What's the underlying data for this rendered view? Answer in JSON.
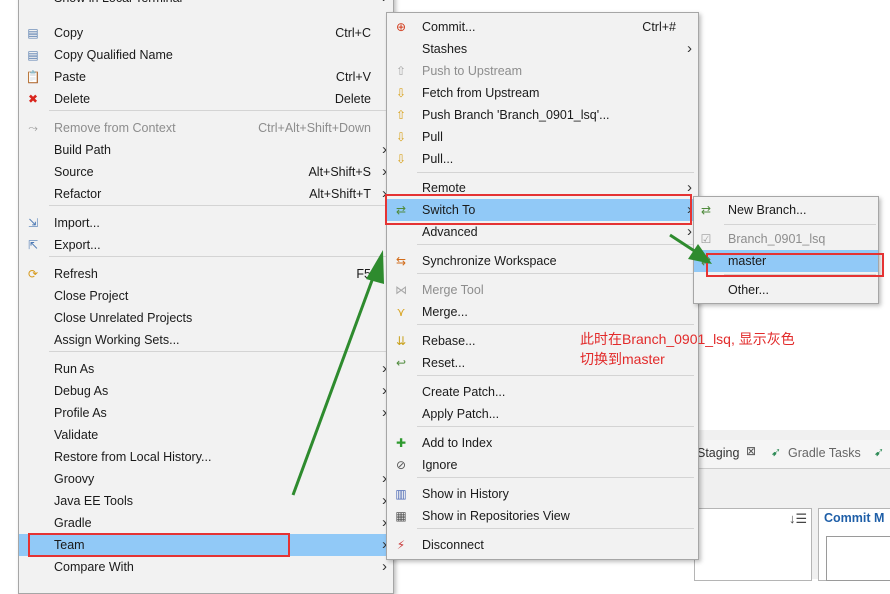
{
  "context_menu": {
    "items": [
      {
        "label": "Show in Local Terminal",
        "shortcut": "",
        "arrow": true,
        "icon": "",
        "disabled": false
      },
      {
        "label": "Copy",
        "shortcut": "Ctrl+C",
        "arrow": false,
        "icon": "copy-icon",
        "disabled": false
      },
      {
        "label": "Copy Qualified Name",
        "shortcut": "",
        "arrow": false,
        "icon": "copy-qualified-icon",
        "disabled": false
      },
      {
        "label": "Paste",
        "shortcut": "Ctrl+V",
        "arrow": false,
        "icon": "paste-icon",
        "disabled": false
      },
      {
        "label": "Delete",
        "shortcut": "Delete",
        "arrow": false,
        "icon": "delete-icon",
        "disabled": false
      },
      {
        "label": "Remove from Context",
        "shortcut": "Ctrl+Alt+Shift+Down",
        "arrow": false,
        "icon": "remove-context-icon",
        "disabled": true
      },
      {
        "label": "Build Path",
        "shortcut": "",
        "arrow": true,
        "icon": "",
        "disabled": false
      },
      {
        "label": "Source",
        "shortcut": "Alt+Shift+S",
        "arrow": true,
        "icon": "",
        "disabled": false
      },
      {
        "label": "Refactor",
        "shortcut": "Alt+Shift+T",
        "arrow": true,
        "icon": "",
        "disabled": false
      },
      {
        "label": "Import...",
        "shortcut": "",
        "arrow": false,
        "icon": "import-icon",
        "disabled": false
      },
      {
        "label": "Export...",
        "shortcut": "",
        "arrow": false,
        "icon": "export-icon",
        "disabled": false
      },
      {
        "label": "Refresh",
        "shortcut": "F5",
        "arrow": false,
        "icon": "refresh-icon",
        "disabled": false
      },
      {
        "label": "Close Project",
        "shortcut": "",
        "arrow": false,
        "icon": "",
        "disabled": false
      },
      {
        "label": "Close Unrelated Projects",
        "shortcut": "",
        "arrow": false,
        "icon": "",
        "disabled": false
      },
      {
        "label": "Assign Working Sets...",
        "shortcut": "",
        "arrow": false,
        "icon": "",
        "disabled": false
      },
      {
        "label": "Run As",
        "shortcut": "",
        "arrow": true,
        "icon": "",
        "disabled": false
      },
      {
        "label": "Debug As",
        "shortcut": "",
        "arrow": true,
        "icon": "",
        "disabled": false
      },
      {
        "label": "Profile As",
        "shortcut": "",
        "arrow": true,
        "icon": "",
        "disabled": false
      },
      {
        "label": "Validate",
        "shortcut": "",
        "arrow": false,
        "icon": "",
        "disabled": false
      },
      {
        "label": "Restore from Local History...",
        "shortcut": "",
        "arrow": false,
        "icon": "",
        "disabled": false
      },
      {
        "label": "Groovy",
        "shortcut": "",
        "arrow": true,
        "icon": "",
        "disabled": false
      },
      {
        "label": "Java EE Tools",
        "shortcut": "",
        "arrow": true,
        "icon": "",
        "disabled": false
      },
      {
        "label": "Gradle",
        "shortcut": "",
        "arrow": true,
        "icon": "",
        "disabled": false
      },
      {
        "label": "Team",
        "shortcut": "",
        "arrow": true,
        "icon": "",
        "disabled": false,
        "highlighted": true
      },
      {
        "label": "Compare With",
        "shortcut": "",
        "arrow": true,
        "icon": "",
        "disabled": false
      }
    ]
  },
  "team_menu": {
    "items": [
      {
        "label": "Commit...",
        "shortcut": "Ctrl+#",
        "arrow": false,
        "icon": "commit-icon",
        "disabled": false
      },
      {
        "label": "Stashes",
        "shortcut": "",
        "arrow": true,
        "icon": "",
        "disabled": false
      },
      {
        "label": "Push to Upstream",
        "shortcut": "",
        "arrow": false,
        "icon": "push-upstream-icon",
        "disabled": true
      },
      {
        "label": "Fetch from Upstream",
        "shortcut": "",
        "arrow": false,
        "icon": "fetch-icon",
        "disabled": false
      },
      {
        "label": "Push Branch 'Branch_0901_lsq'...",
        "shortcut": "",
        "arrow": false,
        "icon": "push-branch-icon",
        "disabled": false
      },
      {
        "label": "Pull",
        "shortcut": "",
        "arrow": false,
        "icon": "pull-icon",
        "disabled": false
      },
      {
        "label": "Pull...",
        "shortcut": "",
        "arrow": false,
        "icon": "pull-dialog-icon",
        "disabled": false
      },
      {
        "label": "Remote",
        "shortcut": "",
        "arrow": true,
        "icon": "",
        "disabled": false
      },
      {
        "label": "Switch To",
        "shortcut": "",
        "arrow": true,
        "icon": "switch-branch-icon",
        "disabled": false,
        "highlighted": true
      },
      {
        "label": "Advanced",
        "shortcut": "",
        "arrow": true,
        "icon": "",
        "disabled": false
      },
      {
        "label": "Synchronize Workspace",
        "shortcut": "",
        "arrow": false,
        "icon": "synchronize-icon",
        "disabled": false
      },
      {
        "label": "Merge Tool",
        "shortcut": "",
        "arrow": false,
        "icon": "merge-tool-icon",
        "disabled": true
      },
      {
        "label": "Merge...",
        "shortcut": "",
        "arrow": false,
        "icon": "merge-icon",
        "disabled": false
      },
      {
        "label": "Rebase...",
        "shortcut": "",
        "arrow": false,
        "icon": "rebase-icon",
        "disabled": false
      },
      {
        "label": "Reset...",
        "shortcut": "",
        "arrow": false,
        "icon": "reset-icon",
        "disabled": false
      },
      {
        "label": "Create Patch...",
        "shortcut": "",
        "arrow": false,
        "icon": "",
        "disabled": false
      },
      {
        "label": "Apply Patch...",
        "shortcut": "",
        "arrow": false,
        "icon": "",
        "disabled": false
      },
      {
        "label": "Add to Index",
        "shortcut": "",
        "arrow": false,
        "icon": "add-index-icon",
        "disabled": false
      },
      {
        "label": "Ignore",
        "shortcut": "",
        "arrow": false,
        "icon": "ignore-icon",
        "disabled": false
      },
      {
        "label": "Show in History",
        "shortcut": "",
        "arrow": false,
        "icon": "history-icon",
        "disabled": false
      },
      {
        "label": "Show in Repositories View",
        "shortcut": "",
        "arrow": false,
        "icon": "repositories-icon",
        "disabled": false
      },
      {
        "label": "Disconnect",
        "shortcut": "",
        "arrow": false,
        "icon": "disconnect-icon",
        "disabled": false
      }
    ]
  },
  "switch_menu": {
    "items": [
      {
        "label": "New Branch...",
        "icon": "new-branch-icon",
        "disabled": false
      },
      {
        "label": "Branch_0901_lsq",
        "icon": "branch-checked-icon",
        "disabled": true
      },
      {
        "label": "master",
        "icon": "branch-icon",
        "disabled": false,
        "highlighted": true
      },
      {
        "label": "Other...",
        "icon": "",
        "disabled": false
      }
    ]
  },
  "annotation": {
    "line1": "此时在Branch_0901_lsq, 显示灰色",
    "line2": "切换到master"
  },
  "background": {
    "staging_tab": "Staging",
    "gradle_tab": "Gradle Tasks",
    "commit_label": "Commit M"
  },
  "colors": {
    "highlight": "#91c9f7",
    "annotation": "#e22a2a",
    "arrow": "#2e8b2e"
  }
}
